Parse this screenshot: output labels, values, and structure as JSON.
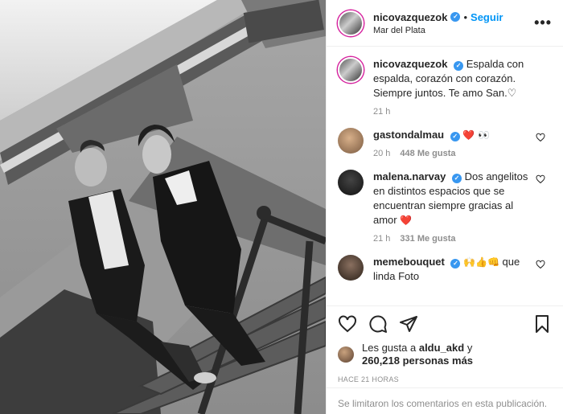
{
  "header": {
    "username": "nicovazquezok",
    "dot": "•",
    "follow_label": "Seguir",
    "location": "Mar del Plata",
    "more_label": "•••"
  },
  "caption": {
    "username": "nicovazquezok",
    "text": "Espalda con espalda, corazón con corazón. Siempre juntos. Te amo San.♡",
    "time": "21 h"
  },
  "comments": [
    {
      "username": "gastondalmau",
      "text": "",
      "emoji": "❤️",
      "time": "20 h",
      "likes": "448 Me gusta",
      "reply": ""
    },
    {
      "username": "malena.narvay",
      "text": "Dos angelitos en distintos espacios que se encuentran siempre gracias al amor",
      "emoji": "❤️",
      "time": "21 h",
      "likes": "331 Me gusta",
      "reply": ""
    },
    {
      "username": "memebouquet",
      "text": "que linda Foto",
      "emoji": "🙌👍👊",
      "time": "",
      "likes": "",
      "reply": ""
    }
  ],
  "likes": {
    "prefix": "Les gusta a",
    "user": "aldu_akd",
    "mid": "y",
    "count": "260,218 personas más"
  },
  "timestamp": "HACE 21 HORAS",
  "comments_limited": "Se limitaron los comentarios en esta publicación.",
  "colors": {
    "link": "#0095f6",
    "verified": "#3897f0",
    "heart": "#ed4956",
    "muted": "#8e8e8e"
  }
}
